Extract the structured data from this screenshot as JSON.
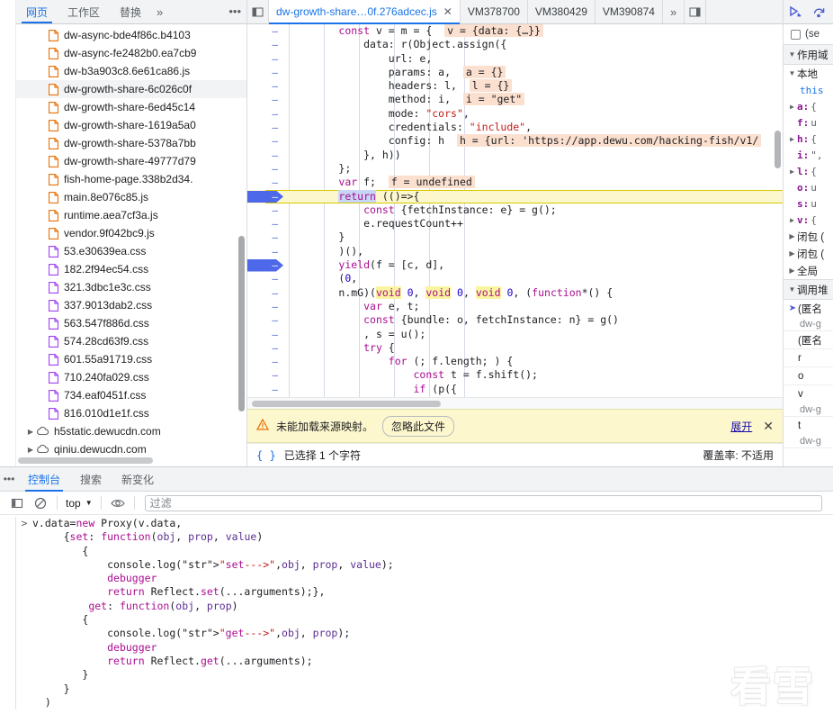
{
  "navigator": {
    "tabs": [
      {
        "label": "网页",
        "selected": true
      },
      {
        "label": "工作区",
        "selected": false
      },
      {
        "label": "替换",
        "selected": false
      }
    ],
    "more_label": "»",
    "menu_icon": "kebab-menu-icon",
    "files": [
      {
        "name": "dw-async-bde4f86c.b4103",
        "type": "js",
        "selected": false
      },
      {
        "name": "dw-async-fe2482b0.ea7cb9",
        "type": "js",
        "selected": false
      },
      {
        "name": "dw-b3a903c8.6e61ca86.js",
        "type": "js",
        "selected": false
      },
      {
        "name": "dw-growth-share-6c026c0f",
        "type": "js",
        "selected": true
      },
      {
        "name": "dw-growth-share-6ed45c14",
        "type": "js",
        "selected": false
      },
      {
        "name": "dw-growth-share-1619a5a0",
        "type": "js",
        "selected": false
      },
      {
        "name": "dw-growth-share-5378a7bb",
        "type": "js",
        "selected": false
      },
      {
        "name": "dw-growth-share-49777d79",
        "type": "js",
        "selected": false
      },
      {
        "name": "fish-home-page.338b2d34.",
        "type": "js",
        "selected": false
      },
      {
        "name": "main.8e076c85.js",
        "type": "js",
        "selected": false
      },
      {
        "name": "runtime.aea7cf3a.js",
        "type": "js",
        "selected": false
      },
      {
        "name": "vendor.9f042bc9.js",
        "type": "js",
        "selected": false
      },
      {
        "name": "53.e30639ea.css",
        "type": "css",
        "selected": false
      },
      {
        "name": "182.2f94ec54.css",
        "type": "css",
        "selected": false
      },
      {
        "name": "321.3dbc1e3c.css",
        "type": "css",
        "selected": false
      },
      {
        "name": "337.9013dab2.css",
        "type": "css",
        "selected": false
      },
      {
        "name": "563.547f886d.css",
        "type": "css",
        "selected": false
      },
      {
        "name": "574.28cd63f9.css",
        "type": "css",
        "selected": false
      },
      {
        "name": "601.55a91719.css",
        "type": "css",
        "selected": false
      },
      {
        "name": "710.240fa029.css",
        "type": "css",
        "selected": false
      },
      {
        "name": "734.eaf0451f.css",
        "type": "css",
        "selected": false
      },
      {
        "name": "816.010d1e1f.css",
        "type": "css",
        "selected": false
      }
    ],
    "domains": [
      {
        "name": "h5static.dewucdn.com"
      },
      {
        "name": "qiniu.dewucdn.com"
      }
    ]
  },
  "editor": {
    "panel_icon": "show-navigator-icon",
    "tabs": [
      {
        "label": "dw-growth-share…0f.276adcec.js",
        "selected": true,
        "closable": true
      },
      {
        "label": "VM378700",
        "selected": false
      },
      {
        "label": "VM380429",
        "selected": false
      },
      {
        "label": "VM390874",
        "selected": false
      }
    ],
    "more_label": "»",
    "right_panel_icon": "show-debugger-icon",
    "lines": [
      {
        "bp": false,
        "text": "const v = m = {",
        "indent": 2,
        "inline": "v = {data: {…}}"
      },
      {
        "bp": false,
        "text": "data: r(Object.assign({",
        "indent": 3
      },
      {
        "bp": false,
        "text": "url: e,",
        "indent": 4
      },
      {
        "bp": false,
        "text": "params: a,",
        "indent": 4,
        "inline": "a = {}"
      },
      {
        "bp": false,
        "text": "headers: l,",
        "indent": 4,
        "inline": "l = {}"
      },
      {
        "bp": false,
        "text": "method: i,",
        "indent": 4,
        "inline": "i = \"get\""
      },
      {
        "bp": false,
        "text": "mode: \"cors\",",
        "indent": 4
      },
      {
        "bp": false,
        "text": "credentials: \"include\",",
        "indent": 4
      },
      {
        "bp": false,
        "text": "config: h",
        "indent": 4,
        "inline": "h = {url: 'https://app.dewu.com/hacking-fish/v1/"
      },
      {
        "bp": false,
        "text": "}, h))",
        "indent": 3
      },
      {
        "bp": false,
        "text": "};",
        "indent": 2
      },
      {
        "bp": false,
        "text": "var f;",
        "indent": 2,
        "inline": "f = undefined"
      },
      {
        "bp": true,
        "text": "return (()=>{",
        "indent": 2,
        "highlight": true
      },
      {
        "bp": false,
        "text": "const {fetchInstance: e} = g();",
        "indent": 3
      },
      {
        "bp": false,
        "text": "e.requestCount++",
        "indent": 3
      },
      {
        "bp": false,
        "text": "}",
        "indent": 2
      },
      {
        "bp": false,
        "text": ")(),",
        "indent": 2
      },
      {
        "bp": true,
        "text": "yield(f = [c, d],",
        "indent": 2
      },
      {
        "bp": false,
        "text": "(0,",
        "indent": 2
      },
      {
        "bp": false,
        "text": "n.mG)(void 0, void 0, void 0, (function*() {",
        "indent": 2
      },
      {
        "bp": false,
        "text": "var e, t;",
        "indent": 3
      },
      {
        "bp": false,
        "text": "const {bundle: o, fetchInstance: n} = g()",
        "indent": 3
      },
      {
        "bp": false,
        "text": ", s = u();",
        "indent": 3
      },
      {
        "bp": false,
        "text": "try {",
        "indent": 3
      },
      {
        "bp": false,
        "text": "for (; f.length; ) {",
        "indent": 4
      },
      {
        "bp": false,
        "text": "const t = f.shift();",
        "indent": 5
      },
      {
        "bp": false,
        "text": "if (p({",
        "indent": 5
      }
    ]
  },
  "warning": {
    "icon": "warning-triangle-icon",
    "message": "未能加载来源映射。",
    "ignore_button": "忽略此文件",
    "expand_link": "展开",
    "close_icon": "close-icon"
  },
  "status": {
    "format_icon": "pretty-print-icon",
    "selection_text": "已选择 1 个字符",
    "coverage_text": "覆盖率: 不适用"
  },
  "debugger": {
    "resume_icon": "resume-script-icon",
    "step_over_icon": "step-over-icon",
    "breakpoint_checkbox_label": "(se",
    "sections": [
      {
        "title": "作用域",
        "expanded": true
      },
      {
        "title": "调用堆",
        "expanded": true
      }
    ],
    "scope": {
      "local_label": "本地",
      "this_label": "this",
      "vars": [
        {
          "expandable": true,
          "name": "a",
          "value": "{"
        },
        {
          "expandable": false,
          "name": "f",
          "value": "u"
        },
        {
          "expandable": true,
          "name": "h",
          "value": "{"
        },
        {
          "expandable": false,
          "name": "i",
          "value": "\","
        },
        {
          "expandable": true,
          "name": "l",
          "value": "{"
        },
        {
          "expandable": false,
          "name": "o",
          "value": "u"
        },
        {
          "expandable": false,
          "name": "s",
          "value": "u"
        },
        {
          "expandable": true,
          "name": "v",
          "value": "{"
        }
      ],
      "groups": [
        "闭包 (",
        "闭包 (",
        "全局"
      ]
    },
    "call_stack": [
      {
        "current": true,
        "fn": "(匿名",
        "src": "dw-g"
      },
      {
        "current": false,
        "fn": "(匿名",
        "src": ""
      },
      {
        "current": false,
        "fn": "r",
        "src": ""
      },
      {
        "current": false,
        "fn": "o",
        "src": ""
      },
      {
        "current": false,
        "fn": "v",
        "src": "dw-g"
      },
      {
        "current": false,
        "fn": "t",
        "src": "dw-g"
      }
    ]
  },
  "console": {
    "menu_icon": "kebab-menu-icon",
    "tabs": [
      {
        "label": "控制台",
        "selected": true
      },
      {
        "label": "搜索",
        "selected": false
      },
      {
        "label": "新变化",
        "selected": false
      }
    ],
    "sidebar_icon": "console-sidebar-icon",
    "clear_icon": "clear-console-icon",
    "context_value": "top",
    "eye_icon": "live-expression-icon",
    "filter_placeholder": "过滤",
    "prompt_symbol": ">",
    "input_lines": [
      "v.data=new Proxy(v.data,",
      "     {set: function(obj, prop, value)",
      "        {",
      "            console.log(\"set--->\",obj, prop, value);",
      "            debugger",
      "            return Reflect.set(...arguments);},",
      "         get: function(obj, prop)",
      "        {",
      "            console.log(\"get--->\",obj, prop);",
      "            debugger",
      "            return Reflect.get(...arguments);",
      "        }",
      "     }",
      "  )"
    ]
  },
  "watermark": {
    "text": "看雪",
    "icon": "snowflake-icon"
  },
  "colors": {
    "accent": "#1a73e8",
    "breakpoint": "#4d68e8",
    "highlight_line": "#fdf7cd",
    "inline_value": "#fbe0cf",
    "js_icon": "#e8710a",
    "css_icon": "#a142f4"
  }
}
